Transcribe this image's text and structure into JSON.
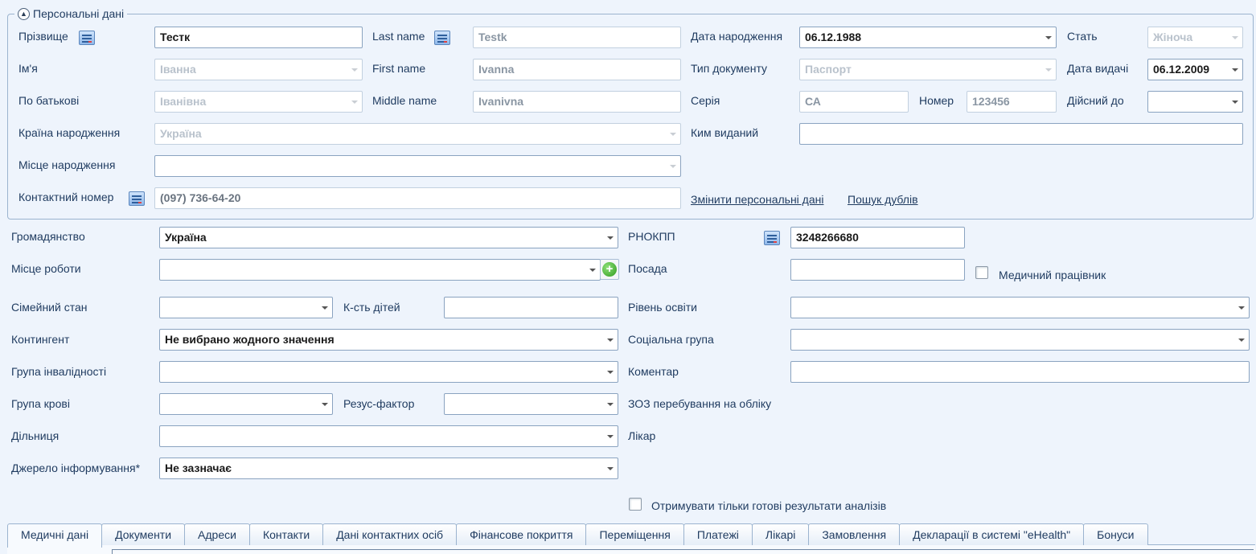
{
  "personal": {
    "legend": "Персональні дані",
    "surname": {
      "label": "Прізвище",
      "value": "Тестк"
    },
    "last_name": {
      "label": "Last name",
      "value": "Testk"
    },
    "birth_date": {
      "label": "Дата народження",
      "value": "06.12.1988"
    },
    "sex": {
      "label": "Стать",
      "value": "Жіноча"
    },
    "first_name_ua": {
      "label": "Ім'я",
      "value": "Іванна"
    },
    "first_name": {
      "label": "First name",
      "value": "Ivanna"
    },
    "doc_type": {
      "label": "Тип документу",
      "value": "Паспорт"
    },
    "issue_date": {
      "label": "Дата видачі",
      "value": "06.12.2009"
    },
    "patronymic": {
      "label": "По батькові",
      "value": "Іванівна"
    },
    "middle_name": {
      "label": "Middle name",
      "value": "Ivanivna"
    },
    "series": {
      "label": "Серія",
      "value": "СА"
    },
    "number": {
      "label": "Номер",
      "value": "123456"
    },
    "valid_until": {
      "label": "Дійсний до",
      "value": ""
    },
    "birth_country": {
      "label": "Країна народження",
      "value": "Україна"
    },
    "issued_by": {
      "label": "Ким виданий",
      "value": ""
    },
    "birth_place": {
      "label": "Місце народження",
      "value": ""
    },
    "contact_phone": {
      "label": "Контактний номер",
      "value": "(097) 736-64-20"
    },
    "change_link": "Змінити персональні дані",
    "duplicates_link": "Пошук дублів"
  },
  "main": {
    "citizenship": {
      "label": "Громадянство",
      "value": "Україна"
    },
    "tax_id": {
      "label": "РНОКПП",
      "value": "3248266680"
    },
    "workplace": {
      "label": "Місце роботи",
      "value": ""
    },
    "position": {
      "label": "Посада",
      "value": ""
    },
    "medical_worker": {
      "label": "Медичний працівник"
    },
    "marital": {
      "label": "Сімейний стан",
      "value": ""
    },
    "children": {
      "label": "К-сть дітей",
      "value": ""
    },
    "education": {
      "label": "Рівень освіти",
      "value": ""
    },
    "contingent": {
      "label": "Контингент",
      "value": "Не вибрано жодного значення"
    },
    "social_group": {
      "label": "Соціальна група",
      "value": ""
    },
    "disability": {
      "label": "Група інвалідності",
      "value": ""
    },
    "comment": {
      "label": "Коментар",
      "value": ""
    },
    "blood_group": {
      "label": "Група крові",
      "value": ""
    },
    "rh_factor": {
      "label": "Резус-фактор",
      "value": ""
    },
    "registration_facility": {
      "label": "ЗОЗ перебування на обліку"
    },
    "district": {
      "label": "Дільниця",
      "value": ""
    },
    "doctor": {
      "label": "Лікар"
    },
    "info_source": {
      "label": "Джерело інформування*",
      "value": "Не зазначає"
    },
    "ready_results": {
      "label": "Отримувати тільки готові результати аналізів"
    }
  },
  "tabs": [
    "Медичні дані",
    "Документи",
    "Адреси",
    "Контакти",
    "Дані контактних осіб",
    "Фінансове покриття",
    "Переміщення",
    "Платежі",
    "Лікарі",
    "Замовлення",
    "Декларації в системі \"eHealth\"",
    "Бонуси"
  ]
}
